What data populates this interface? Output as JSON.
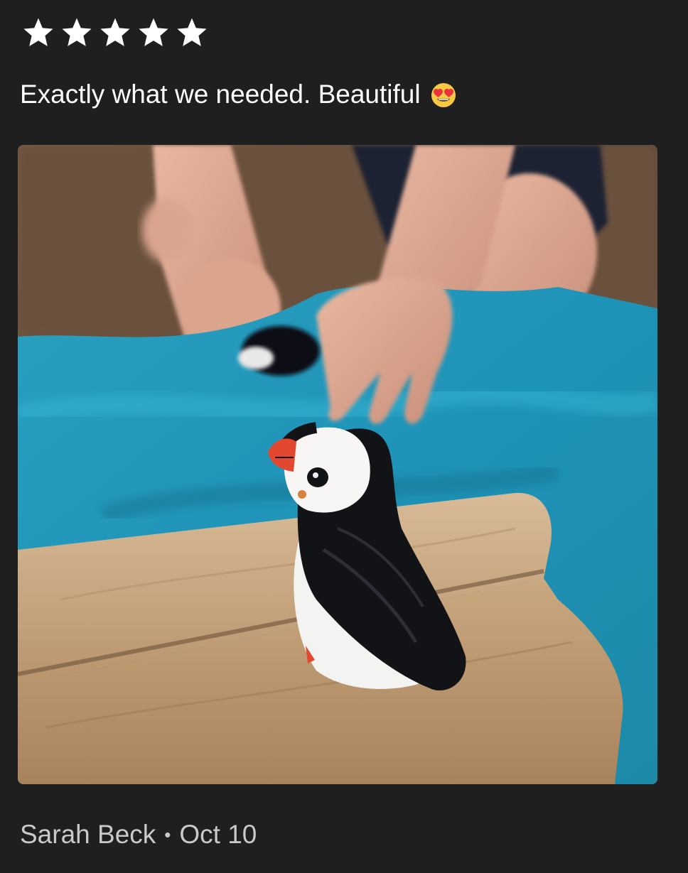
{
  "review": {
    "rating": 5,
    "rating_max": 5,
    "star_color": "#ffffff",
    "text": "Exactly what we needed. Beautiful",
    "emoji": "smiling-face-with-heart-eyes",
    "author": "Sarah Beck",
    "separator": "•",
    "date": "Oct 10"
  },
  "colors": {
    "background": "#1f1f1f",
    "byline_text": "#c9c9c9"
  }
}
